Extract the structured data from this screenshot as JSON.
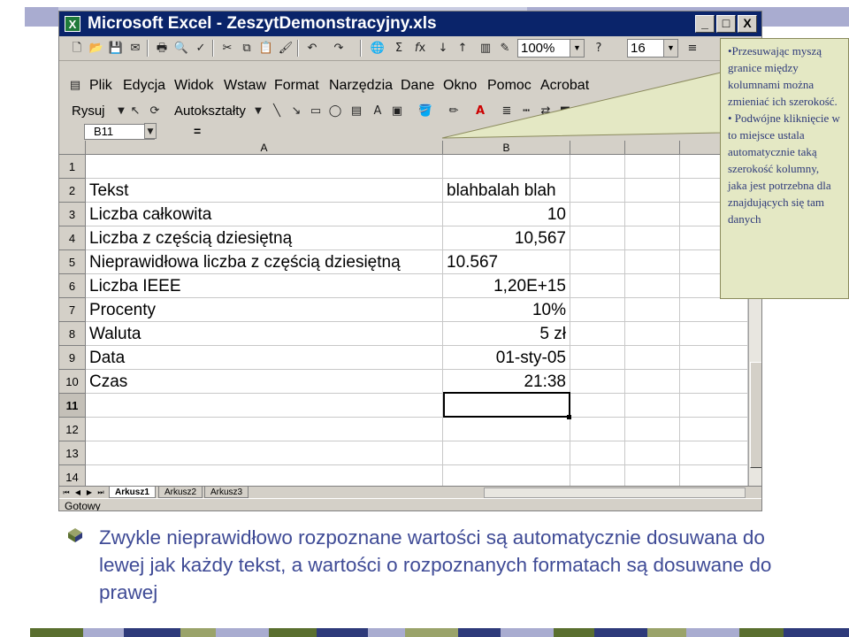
{
  "window": {
    "app_icon": "X",
    "title": "Microsoft Excel - ZeszytDemonstracyjny.xls",
    "min_label": "_",
    "max_label": "□",
    "close_label": "X"
  },
  "standard_toolbar": {
    "zoom": "100%",
    "font_size": "16",
    "icons": [
      "new-icon",
      "open-icon",
      "save-icon",
      "email-icon",
      "print-icon",
      "print-preview-icon",
      "spelling-icon",
      "cut-icon",
      "copy-icon",
      "paste-icon",
      "format-painter-icon",
      "undo-icon",
      "redo-icon",
      "hyperlink-icon",
      "autosum-icon",
      "function-icon",
      "sort-ascending-icon",
      "sort-descending-icon",
      "chart-wizard-icon",
      "drawing-icon",
      "help-icon",
      "align-icon"
    ]
  },
  "menu": {
    "items": [
      "Plik",
      "Edycja",
      "Widok",
      "Wstaw",
      "Format",
      "Narzędzia",
      "Dane",
      "Okno",
      "Pomoc",
      "Acrobat"
    ]
  },
  "drawing_toolbar": {
    "draw_label": "Rysuj",
    "autoshapes_label": "Autokształty"
  },
  "formula_bar": {
    "name_box": "B11",
    "equals": "="
  },
  "columns": [
    "A",
    "B"
  ],
  "rows": [
    {
      "n": "1",
      "a": "",
      "b": ""
    },
    {
      "n": "2",
      "a": "Tekst",
      "b": "blahbalah blah"
    },
    {
      "n": "3",
      "a": "Liczba całkowita",
      "b": "10"
    },
    {
      "n": "4",
      "a": "Liczba z częścią dziesiętną",
      "b": "10,567"
    },
    {
      "n": "5",
      "a": "Nieprawidłowa liczba z częścią dziesiętną",
      "b": "10.567"
    },
    {
      "n": "6",
      "a": "Liczba IEEE",
      "b": "1,20E+15"
    },
    {
      "n": "7",
      "a": "Procenty",
      "b": "10%"
    },
    {
      "n": "8",
      "a": "Waluta",
      "b": "5 zł"
    },
    {
      "n": "9",
      "a": "Data",
      "b": "01-sty-05"
    },
    {
      "n": "10",
      "a": "Czas",
      "b": "21:38"
    },
    {
      "n": "11",
      "a": "",
      "b": ""
    },
    {
      "n": "12",
      "a": "",
      "b": ""
    },
    {
      "n": "13",
      "a": "",
      "b": ""
    },
    {
      "n": "14",
      "a": "",
      "b": ""
    }
  ],
  "sheet_tabs": [
    "Arkusz1",
    "Arkusz2",
    "Arkusz3"
  ],
  "status": "Gotowy",
  "callout": {
    "bullet1": "•Przesuwając myszą granice między kolumnami można zmieniać ich szerokość.",
    "bullet2": "• Podwójne kliknięcie w to miejsce ustala automatycznie taką szerokość kolumny, jaka jest potrzebna dla znajdujących się tam danych"
  },
  "caption": "Zwykle nieprawidłowo rozpoznane wartości są automatycznie dosuwana do lewej jak każdy tekst, a wartości o rozpoznanych formatach są dosuwane do prawej",
  "colors": {
    "deco_green": "#5a6f2f",
    "deco_navy": "#2e3a7a",
    "deco_olive": "#9aa36a",
    "deco_lavender": "#a9acd0",
    "caption_text": "#3f4b96",
    "callout_bg": "#e4e8c4",
    "titlebar": "#0a246a"
  }
}
